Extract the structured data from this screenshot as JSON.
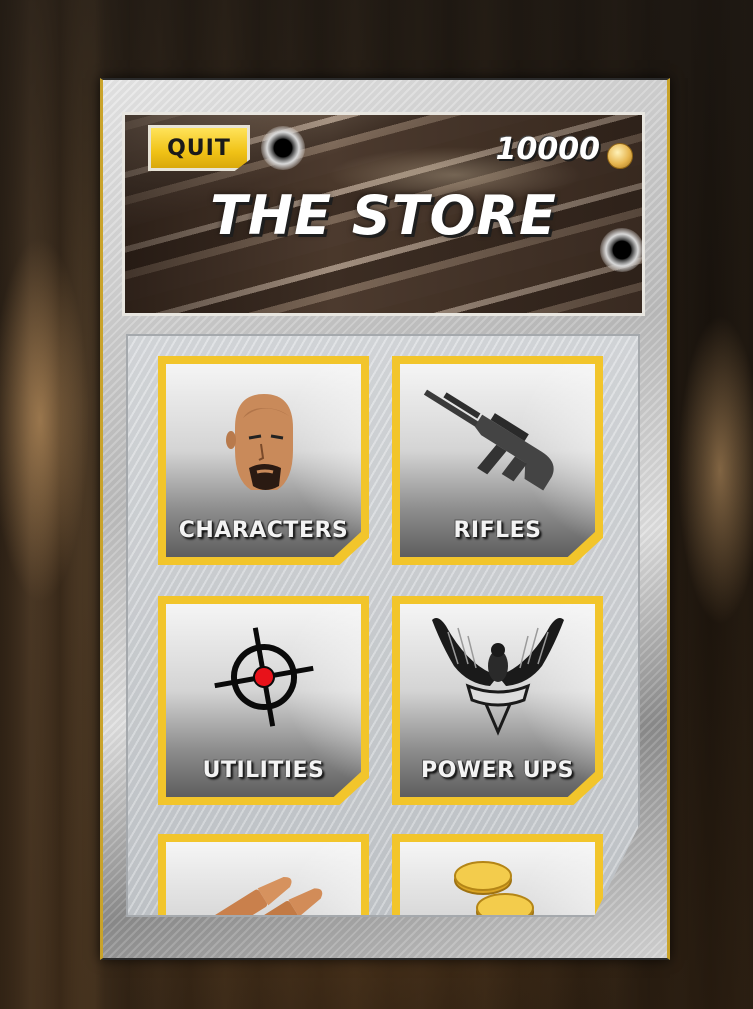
{
  "header": {
    "quit_label": "QUIT",
    "coins": "10000",
    "title": "THE STORE"
  },
  "tiles": [
    {
      "label": "CHARACTERS",
      "icon": "character-head-icon"
    },
    {
      "label": "RIFLES",
      "icon": "rifle-icon"
    },
    {
      "label": "UTILITIES",
      "icon": "crosshair-icon"
    },
    {
      "label": "POWER UPS",
      "icon": "eagle-emblem-icon"
    },
    {
      "label": "",
      "icon": "ammo-bullets-icon"
    },
    {
      "label": "",
      "icon": "gold-coins-icon"
    }
  ],
  "colors": {
    "accent": "#f2c52b",
    "title_text": "#ffffff",
    "crosshair_dot": "#e8121a"
  }
}
